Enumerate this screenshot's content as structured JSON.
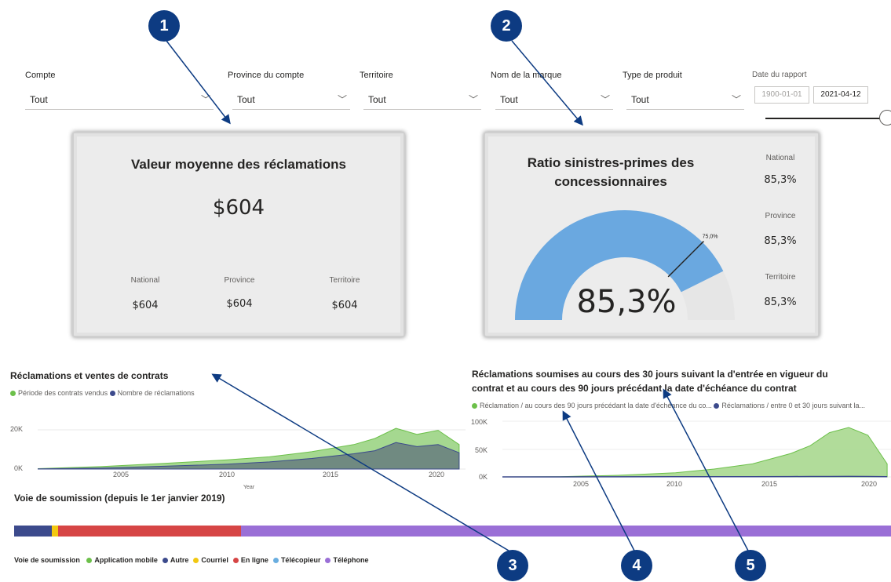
{
  "filters": {
    "compte": {
      "label": "Compte",
      "value": "Tout"
    },
    "province": {
      "label": "Province du compte",
      "value": "Tout"
    },
    "territoire": {
      "label": "Territoire",
      "value": "Tout"
    },
    "marque": {
      "label": "Nom de la marque",
      "value": "Tout"
    },
    "produit": {
      "label": "Type de produit",
      "value": "Tout"
    },
    "date": {
      "label": "Date du rapport",
      "start": "1900-01-01",
      "end": "2021-04-12"
    }
  },
  "card_claims": {
    "title": "Valeur moyenne des réclamations",
    "value": "$604",
    "national_label": "National",
    "national_value": "$604",
    "province_label": "Province",
    "province_value": "$604",
    "territoire_label": "Territoire",
    "territoire_value": "$604"
  },
  "card_ratio": {
    "title_line1": "Ratio sinistres-primes des",
    "title_line2": "concessionnaires",
    "value": "85,3%",
    "target_label": "75,0%",
    "national_label": "National",
    "national_value": "85,3%",
    "province_label": "Province",
    "province_value": "85,3%",
    "territoire_label": "Territoire",
    "territoire_value": "85,3%"
  },
  "chart_left": {
    "title": "Réclamations et ventes de contrats",
    "legend": [
      "Période des contrats vendus",
      "Nombre de réclamations"
    ],
    "y_ticks": [
      "20K",
      "0K"
    ],
    "x_ticks": [
      "2005",
      "2010",
      "2015",
      "2020"
    ],
    "x_label": "Year"
  },
  "chart_right": {
    "title_line1": "Réclamations soumises au cours des 30 jours suivant la d'entrée en vigueur du",
    "title_line2": "contrat et au cours des 90 jours précédant la date d'échéance du contrat",
    "legend": [
      "Réclamation / au cours des 90 jours précédant la date d'échéance du co...",
      "Réclamations / entre 0 et 30 jours suivant la..."
    ],
    "y_ticks": [
      "100K",
      "50K",
      "0K"
    ],
    "x_ticks": [
      "2005",
      "2010",
      "2015",
      "2020"
    ]
  },
  "submission": {
    "title": "Voie de soumission (depuis le 1er janvier 2019)",
    "legend_title": "Voie de soumission",
    "legend": [
      "Application mobile",
      "Autre",
      "Courriel",
      "En ligne",
      "Télécopieur",
      "Téléphone"
    ]
  },
  "badges": [
    "1",
    "2",
    "3",
    "4",
    "5"
  ],
  "colors": {
    "green": "#6cc04a",
    "navy": "#3c4a8c",
    "yellow": "#f2c811",
    "red": "#d64545",
    "lightblue": "#6aaee0",
    "purple": "#9a6fd6",
    "gauge": "#6aa8e0",
    "badge": "#0d3b82"
  },
  "chart_data": [
    {
      "type": "area",
      "title": "Réclamations et ventes de contrats",
      "x": [
        2001,
        2004,
        2007,
        2010,
        2012,
        2014,
        2016,
        2017,
        2018,
        2019,
        2020,
        2021
      ],
      "ylim": [
        0,
        30000
      ],
      "series": [
        {
          "name": "Période des contrats vendus",
          "values": [
            200,
            1200,
            2800,
            4500,
            6000,
            8500,
            12000,
            15000,
            20000,
            17000,
            19000,
            12000
          ]
        },
        {
          "name": "Nombre de réclamations",
          "values": [
            100,
            500,
            1400,
            2400,
            3500,
            5200,
            7500,
            9000,
            13000,
            11000,
            12000,
            8000
          ]
        }
      ]
    },
    {
      "type": "area",
      "title": "Réclamations soumises au cours des 30 jours suivant la d'entrée en vigueur du contrat et au cours des 90 jours précédant la date d'échéance du contrat",
      "x": [
        2001,
        2004,
        2007,
        2010,
        2012,
        2014,
        2016,
        2017,
        2018,
        2019,
        2020,
        2021
      ],
      "ylim": [
        0,
        110000
      ],
      "series": [
        {
          "name": "Réclamation / au cours des 90 jours précédant la date d'échéance du co...",
          "values": [
            0,
            500,
            3000,
            8000,
            15000,
            25000,
            45000,
            60000,
            85000,
            95000,
            80000,
            25000
          ]
        },
        {
          "name": "Réclamations / entre 0 et 30 jours suivant la...",
          "values": [
            0,
            0,
            200,
            300,
            400,
            500,
            600,
            700,
            800,
            900,
            800,
            500
          ]
        }
      ]
    },
    {
      "type": "bar",
      "title": "Voie de soumission (depuis le 1er janvier 2019)",
      "categories": [
        "Application mobile",
        "Autre",
        "Courriel",
        "En ligne",
        "Télécopieur",
        "Téléphone"
      ],
      "values": [
        0,
        4.3,
        0.7,
        20.9,
        0,
        74.1
      ]
    }
  ]
}
